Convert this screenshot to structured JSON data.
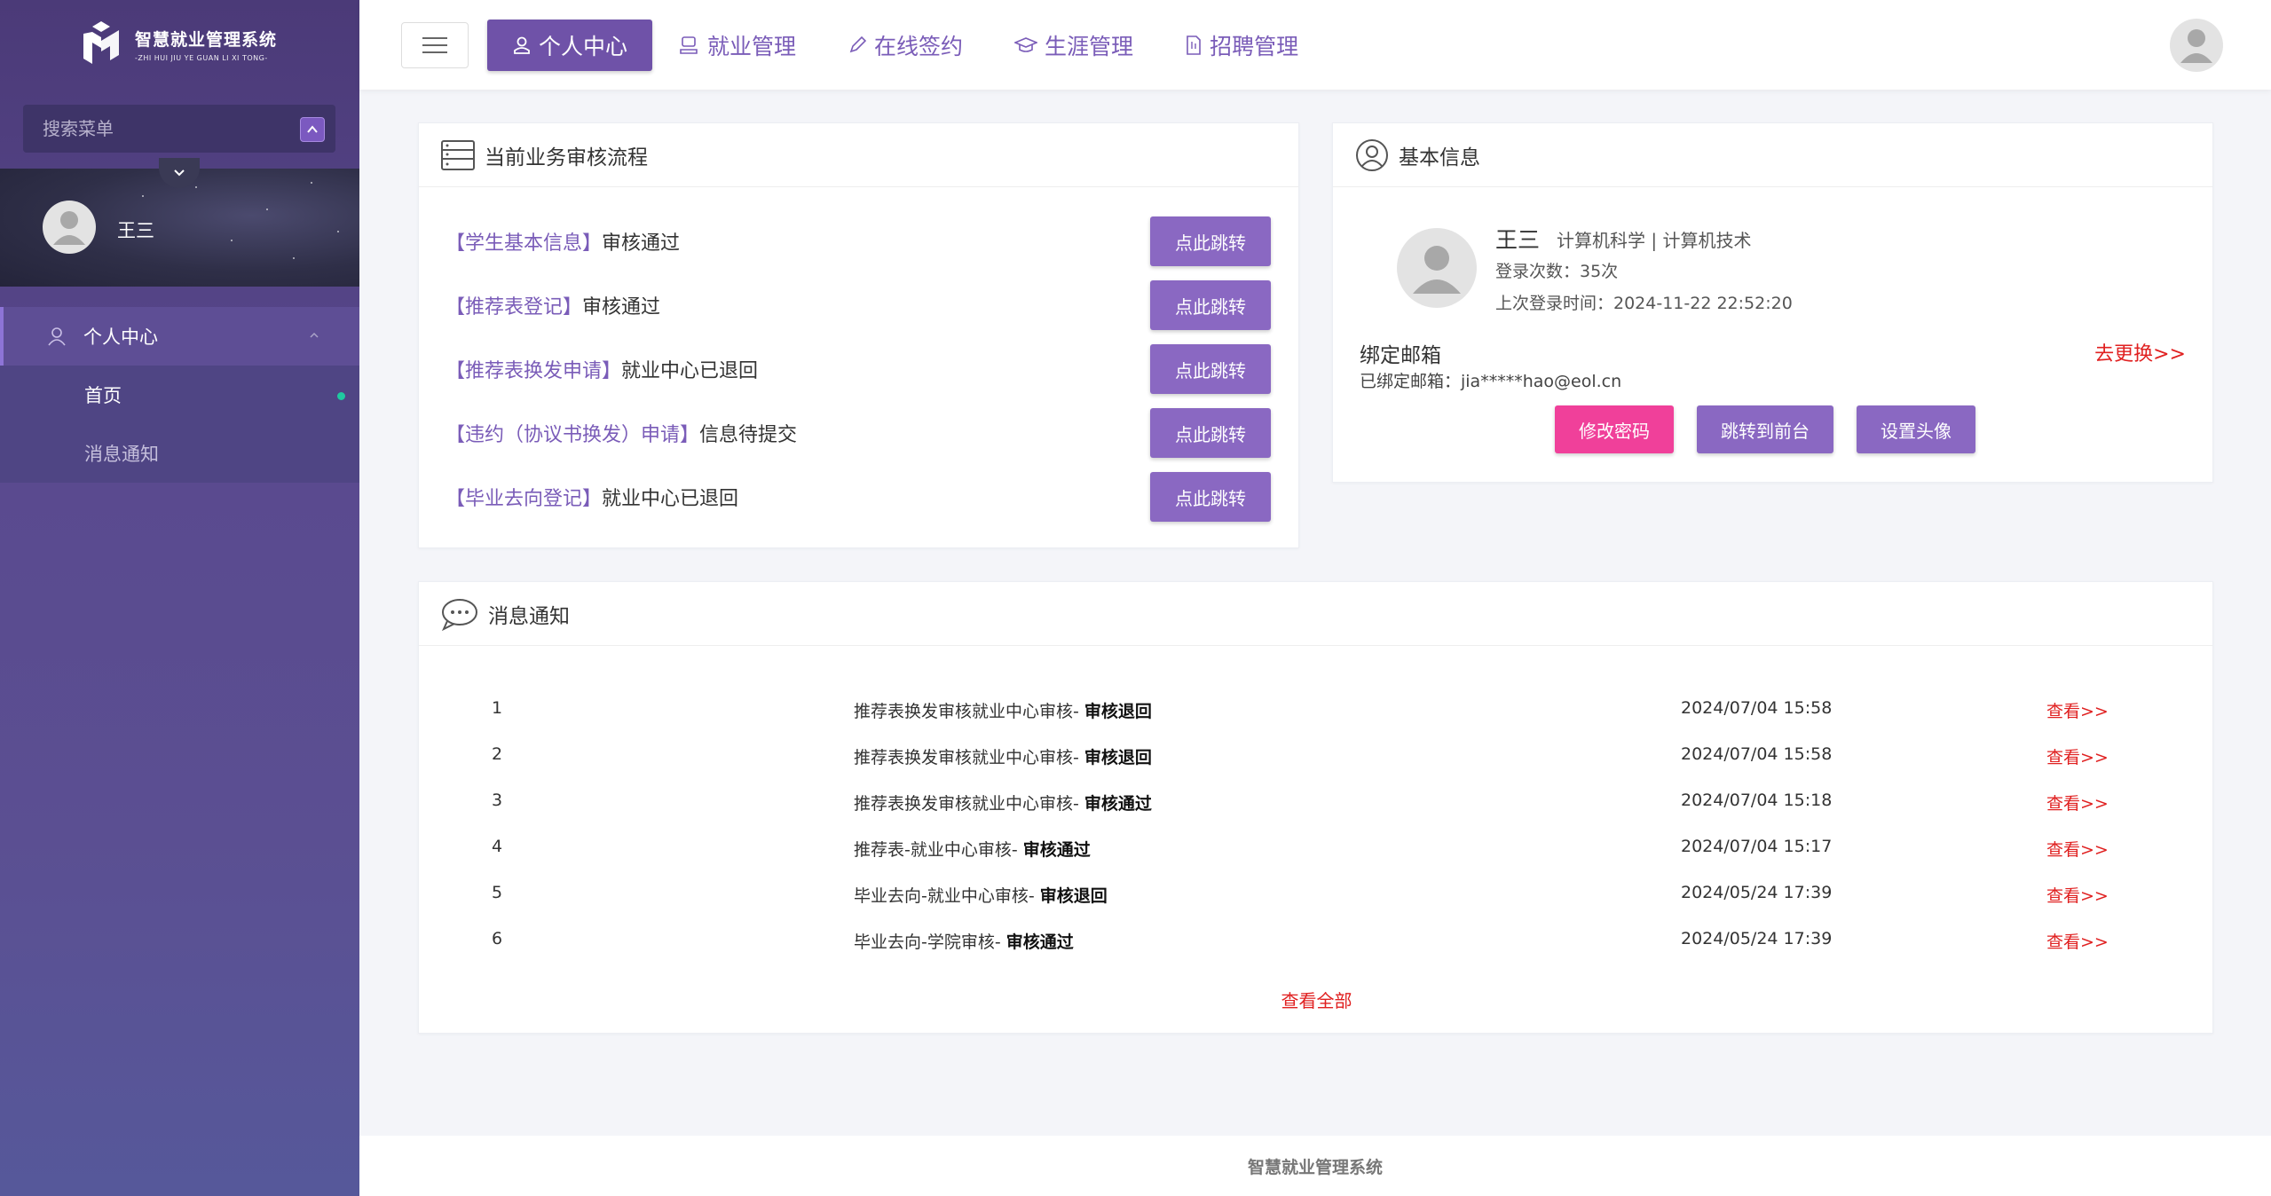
{
  "sidebar": {
    "logo_title": "智慧就业管理系统",
    "logo_sub": "-ZHI HUI JIU YE GUAN LI XI TONG-",
    "search_placeholder": "搜索菜单",
    "username": "王三",
    "menu": {
      "parent": "个人中心",
      "children": [
        "首页",
        "消息通知"
      ]
    }
  },
  "topnav": {
    "items": [
      "个人中心",
      "就业管理",
      "在线签约",
      "生涯管理",
      "招聘管理"
    ]
  },
  "flow": {
    "title": "当前业务审核流程",
    "button_label": "点此跳转",
    "rows": [
      {
        "link": "【学生基本信息】",
        "status": "审核通过"
      },
      {
        "link": "【推荐表登记】",
        "status": "审核通过"
      },
      {
        "link": "【推荐表换发申请】",
        "status": "就业中心已退回"
      },
      {
        "link": "【违约（协议书换发）申请】",
        "status": "信息待提交"
      },
      {
        "link": "【毕业去向登记】",
        "status": "就业中心已退回"
      }
    ]
  },
  "info": {
    "title": "基本信息",
    "name": "王三",
    "major": "计算机科学 | 计算机技术",
    "login_count": "登录次数：35次",
    "last_login": "上次登录时间：2024-11-22 22:52:20",
    "email_title": "绑定邮箱",
    "email_bound": "已绑定邮箱：jia*****hao@eol.cn",
    "change_link": "去更换>>",
    "buttons": {
      "password": "修改密码",
      "frontend": "跳转到前台",
      "avatar": "设置头像"
    },
    "colors": {
      "pink": "#f0409a",
      "purple": "#8a68c2"
    }
  },
  "messages": {
    "title": "消息通知",
    "view_label": "查看>>",
    "view_all": "查看全部",
    "rows": [
      {
        "idx": "1",
        "prefix": "推荐表换发审核就业中心审核- ",
        "result": "审核退回",
        "time": "2024/07/04 15:58"
      },
      {
        "idx": "2",
        "prefix": "推荐表换发审核就业中心审核- ",
        "result": "审核退回",
        "time": "2024/07/04 15:58"
      },
      {
        "idx": "3",
        "prefix": "推荐表换发审核就业中心审核- ",
        "result": "审核通过",
        "time": "2024/07/04 15:18"
      },
      {
        "idx": "4",
        "prefix": "推荐表-就业中心审核- ",
        "result": "审核通过",
        "time": "2024/07/04 15:17"
      },
      {
        "idx": "5",
        "prefix": "毕业去向-就业中心审核- ",
        "result": "审核退回",
        "time": "2024/05/24 17:39"
      },
      {
        "idx": "6",
        "prefix": "毕业去向-学院审核- ",
        "result": "审核通过",
        "time": "2024/05/24 17:39"
      }
    ]
  },
  "footer": "智慧就业管理系统"
}
